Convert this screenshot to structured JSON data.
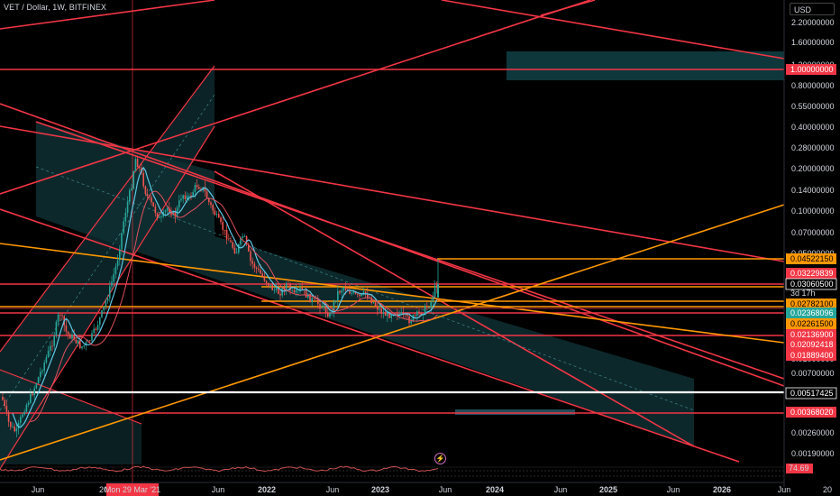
{
  "header": {
    "symbol": "VET",
    "pair": "Dollar",
    "interval": "1W",
    "exchange": "BITFINEX",
    "currency": "USD"
  },
  "chart_data": {
    "type": "candlestick",
    "scale": "log",
    "y_ticks": [
      "2.20000000",
      "1.60000000",
      "1.20000000",
      "0.80000000",
      "0.55000000",
      "0.40000000",
      "0.28000000",
      "0.20000000",
      "0.14000000",
      "0.10000000",
      "0.07000000",
      "0.05000000",
      "0.03300000",
      "0.02000000",
      "0.01400000",
      "0.01000000",
      "0.00700000",
      "0.00510000",
      "0.00360000",
      "0.00260000",
      "0.00190000"
    ],
    "x_ticks": [
      "Jun",
      "20",
      "Mon 29 Mar '21",
      "Jun",
      "2022",
      "Jun",
      "2023",
      "Jun",
      "2024",
      "Jun",
      "2025",
      "Jun",
      "2026",
      "Jun",
      "20"
    ],
    "price_labels": [
      {
        "text": "1.00000000",
        "color": "#f23645"
      },
      {
        "text": "0.04522150",
        "color": "#ff9800"
      },
      {
        "text": "0.03229839",
        "color": "#f23645"
      },
      {
        "text": "0.03060500",
        "color": "#ffffff"
      },
      {
        "text": "3d 17h",
        "color": "#ffffff"
      },
      {
        "text": "0.02782100",
        "color": "#ff9800"
      },
      {
        "text": "0.02368096",
        "color": "#26a69a"
      },
      {
        "text": "0.02261500",
        "color": "#ff9800"
      },
      {
        "text": "0.02136900",
        "color": "#f23645"
      },
      {
        "text": "0.02092418",
        "color": "#f23645"
      },
      {
        "text": "0.01889400",
        "color": "#f23645"
      },
      {
        "text": "0.00517425",
        "color": "#ffffff"
      },
      {
        "text": "0.00368020",
        "color": "#f23645"
      }
    ],
    "indicator": {
      "values": [
        "74.69"
      ]
    },
    "crosshair_date": "Mon 29 Mar '21",
    "colors": {
      "up": "#26a69a",
      "down": "#ef5350",
      "line_red": "#f23645",
      "line_orange": "#ff9800",
      "box": "#0e3a3e"
    }
  }
}
